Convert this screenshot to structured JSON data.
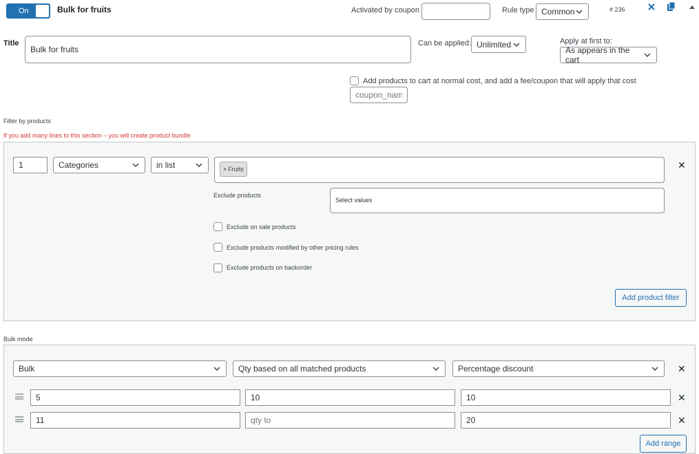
{
  "header": {
    "toggle_label": "On",
    "rule_name": "Bulk for fruits",
    "activated_by_coupon_label": "Activated by coupon",
    "activated_by_coupon_value": "",
    "rule_type_label": "Rule type",
    "rule_type_value": "Common",
    "rule_id": "# 236"
  },
  "rule": {
    "title_label": "Title",
    "title_value": "Bulk for fruits",
    "can_be_applied_label": "Can be applied:",
    "can_be_applied_value": "Unlimited",
    "apply_first_label": "Apply at first to:",
    "apply_first_value": "As appears in the cart",
    "fee_checkbox_label": "Add products to cart at normal cost, and add a fee/coupon that will apply that cost",
    "coupon_name_placeholder": "coupon_name"
  },
  "filter": {
    "section_label": "Filter by products",
    "warning": "If you add many lines to this section – you will create product bundle",
    "qty_value": "1",
    "type_value": "Categories",
    "method_value": "in list",
    "tags": [
      "Fruits"
    ],
    "exclude_label": "Exclude products",
    "exclude_placeholder": "Select values",
    "opt_on_sale": "Exclude on sale products",
    "opt_modified": "Exclude products modified by other pricing rules",
    "opt_backorder": "Exclude products on backorder",
    "add_filter_label": "Add product filter"
  },
  "bulk": {
    "section_label": "Bulk mode",
    "mode_value": "Bulk",
    "qty_based_value": "Qty based on all matched products",
    "discount_type_value": "Percentage discount",
    "ranges": [
      {
        "from": "5",
        "to": "10",
        "to_placeholder": "",
        "value": "10"
      },
      {
        "from": "11",
        "to": "",
        "to_placeholder": "qty to",
        "value": "20"
      }
    ],
    "add_range_label": "Add range"
  },
  "colors": {
    "accent": "#2271b1",
    "warning": "#d63638",
    "panel_bg": "#f6f7f7",
    "border": "#c3c4c7"
  }
}
